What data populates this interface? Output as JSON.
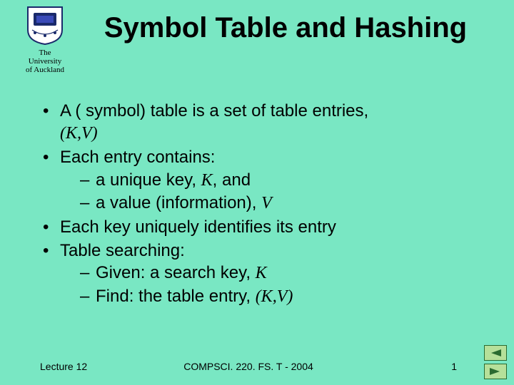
{
  "university": {
    "line1": "The",
    "line2": "University",
    "line3": "of Auckland"
  },
  "title": "Symbol Table and Hashing",
  "bullets": {
    "b1_a": "A ( symbol) table is a set of  table entries, ",
    "b1_kv": "(K,V)",
    "b2": "Each entry contains:",
    "b2_s1_a": "a unique  key, ",
    "b2_s1_k": "K",
    "b2_s1_b": ", and",
    "b2_s2_a": "a  value (information), ",
    "b2_s2_v": "V",
    "b3": "Each key uniquely identifies its entry",
    "b4": "Table searching:",
    "b4_s1_a": "Given: a search key, ",
    "b4_s1_k": "K",
    "b4_s2_a": "Find: the table entry, ",
    "b4_s2_kv": "(K,V)"
  },
  "footer": {
    "left": "Lecture 12",
    "center": "COMPSCI. 220. FS. T - 2004",
    "page": "1"
  },
  "icons": {
    "prev": "prev-arrow",
    "next": "next-arrow"
  }
}
